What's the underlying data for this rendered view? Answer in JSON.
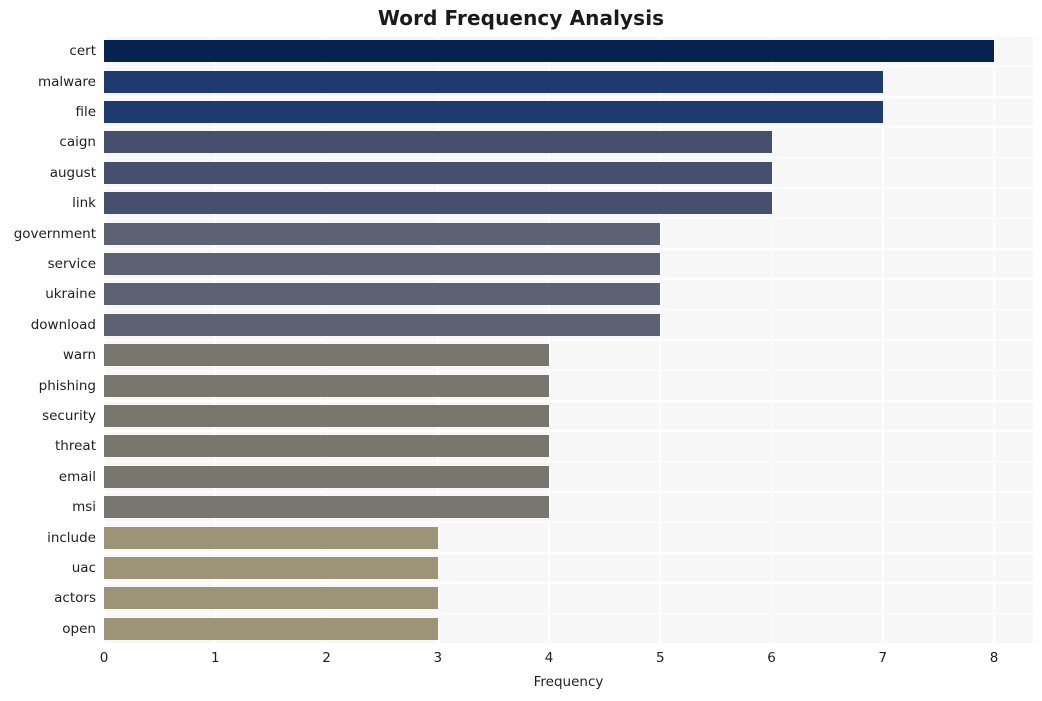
{
  "chart_data": {
    "type": "bar",
    "orientation": "horizontal",
    "title": "Word Frequency Analysis",
    "xlabel": "Frequency",
    "ylabel": "",
    "xlim": [
      0,
      8.35
    ],
    "xticks": [
      0,
      1,
      2,
      3,
      4,
      5,
      6,
      7,
      8
    ],
    "xtick_labels": [
      "0",
      "1",
      "2",
      "3",
      "4",
      "5",
      "6",
      "7",
      "8"
    ],
    "grid": true,
    "legend": null,
    "categories": [
      "cert",
      "malware",
      "file",
      "caign",
      "august",
      "link",
      "government",
      "service",
      "ukraine",
      "download",
      "warn",
      "phishing",
      "security",
      "threat",
      "email",
      "msi",
      "include",
      "uac",
      "actors",
      "open"
    ],
    "values": [
      8,
      7,
      7,
      6,
      6,
      6,
      5,
      5,
      5,
      5,
      4,
      4,
      4,
      4,
      4,
      4,
      3,
      3,
      3,
      3
    ],
    "bar_colors": [
      "#06234f",
      "#1f3a6e",
      "#1f3a6e",
      "#454f6e",
      "#454f6e",
      "#454f6e",
      "#5c6173",
      "#5c6173",
      "#5c6173",
      "#5c6173",
      "#77776f",
      "#77776f",
      "#77776f",
      "#77776f",
      "#77776f",
      "#77776f",
      "#9b9477",
      "#9b9477",
      "#9b9477",
      "#9b9477"
    ],
    "plot_background": "#f7f7f7",
    "grid_color": "#ffffff",
    "figure_background": "#ffffff"
  }
}
